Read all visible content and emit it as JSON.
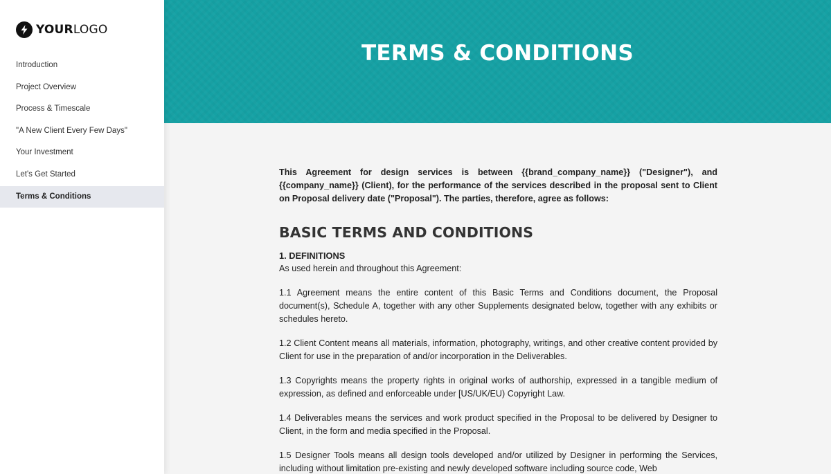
{
  "sidebar": {
    "logo": {
      "bold": "YOUR",
      "light": "LOGO",
      "icon": "lightning-bolt-icon"
    },
    "items": [
      {
        "label": "Introduction",
        "active": false
      },
      {
        "label": "Project Overview",
        "active": false
      },
      {
        "label": "Process & Timescale",
        "active": false
      },
      {
        "label": "\"A New Client Every Few Days\"",
        "active": false
      },
      {
        "label": "Your Investment",
        "active": false
      },
      {
        "label": "Let's Get Started",
        "active": false
      },
      {
        "label": "Terms & Conditions",
        "active": true
      }
    ]
  },
  "hero": {
    "title": "TERMS & CONDITIONS",
    "color": "#15a1a4"
  },
  "content": {
    "intro": "This Agreement for design services is between {{brand_company_name}} (\"Designer\"), and {{company_name}} (Client), for the performance of the services described in the proposal sent to Client on Proposal delivery date (\"Proposal\"). The parties, therefore, agree as follows:",
    "section_title": "BASIC TERMS AND CONDITIONS",
    "definitions_title": "1. DEFINITIONS",
    "definitions_lead": "As used herein and throughout this Agreement:",
    "paragraphs": [
      "1.1 Agreement means the entire content of this Basic Terms and Conditions document, the Proposal document(s), Schedule A, together with any other Supplements designated below, together with any exhibits or schedules hereto.",
      "1.2 Client Content means all materials, information, photography, writings, and other creative content provided by Client for use in the preparation of and/or incorporation in the Deliverables.",
      "1.3 Copyrights means the property rights in original works of authorship, expressed in a tangible medium of expression, as defined and enforceable under [US/UK/EU) Copyright Law.",
      "1.4 Deliverables means the services and work product specified in the Proposal to be delivered by Designer to Client, in the form and media specified in the Proposal.",
      "1.5 Designer Tools means all design tools developed and/or utilized by Designer in performing the Services, including without limitation pre-existing and newly developed software including source code, Web"
    ]
  }
}
